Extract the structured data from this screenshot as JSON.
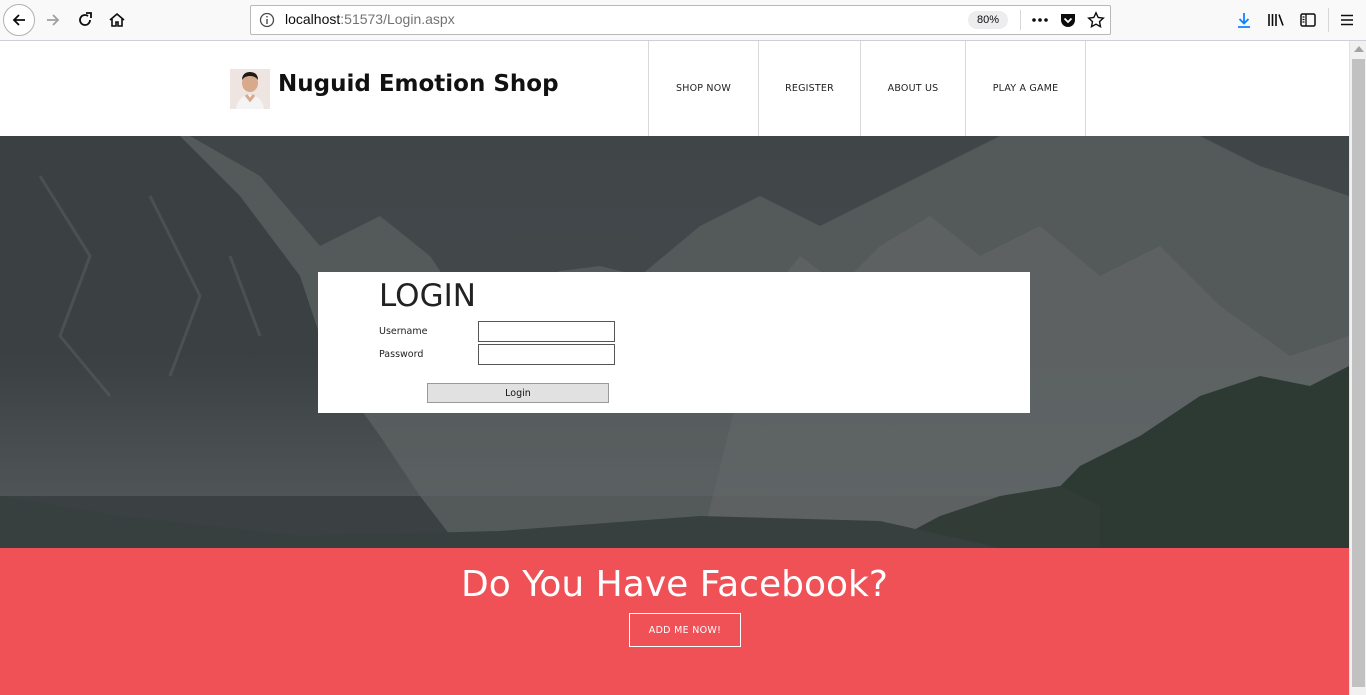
{
  "browser": {
    "url_host": "localhost",
    "url_path": ":51573/Login.aspx",
    "zoom": "80%"
  },
  "header": {
    "brand": "Nuguid Emotion Shop",
    "nav": [
      {
        "label": "SHOP NOW"
      },
      {
        "label": "REGISTER"
      },
      {
        "label": "ABOUT US"
      },
      {
        "label": "PLAY A GAME"
      }
    ]
  },
  "login": {
    "title": "LOGIN",
    "username_label": "Username",
    "password_label": "Password",
    "button_label": "Login"
  },
  "facebook": {
    "title": "Do You Have Facebook?",
    "button_label": "ADD ME NOW!"
  },
  "colors": {
    "accent": "#ef5157",
    "hero_overlay": "#3f4446",
    "download_icon": "#0a84ff"
  }
}
